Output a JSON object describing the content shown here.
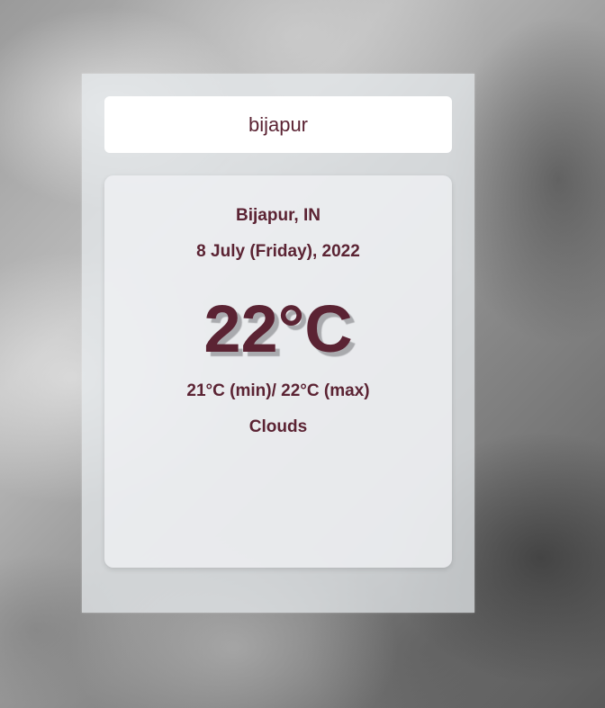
{
  "search": {
    "value": "bijapur",
    "placeholder": ""
  },
  "weather": {
    "location": "Bijapur, IN",
    "date": "8 July (Friday), 2022",
    "temperature": "22°C",
    "min_max": "21°C (min)/ 22°C (max)",
    "condition": "Clouds"
  },
  "colors": {
    "accent_text": "#5b2333",
    "card_background": "#f0f1f3",
    "search_background": "#ffffff"
  }
}
